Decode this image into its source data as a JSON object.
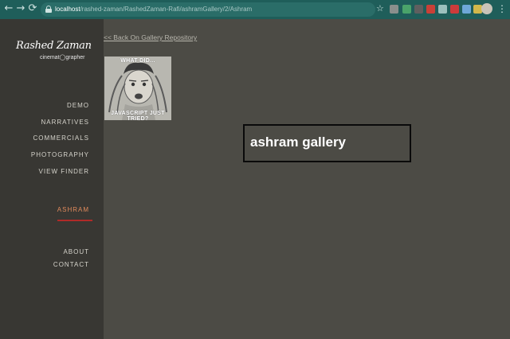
{
  "browser": {
    "url_host": "localhost",
    "url_path": "/rashed-zaman/RashedZaman-Rafi/ashramGallery/2/Ashram",
    "nav_back_icon": "←",
    "nav_forward_icon": "→",
    "nav_reload_icon": "⟳",
    "star_icon": "☆",
    "menu_icon": "⋮",
    "extension_colors": [
      "#8a8f8c",
      "#4aa36a",
      "#5f5f5f",
      "#c94037",
      "#9cc0bd",
      "#cc3b3b",
      "#6ea8d8",
      "#d2b84b"
    ]
  },
  "sidebar": {
    "logo_name": "Rashed Zaman",
    "logo_role": "cinemat◯grapher",
    "menu": [
      {
        "label": "DEMO"
      },
      {
        "label": "NARRATIVES"
      },
      {
        "label": "COMMERCIALS"
      },
      {
        "label": "PHOTOGRAPHY"
      },
      {
        "label": "VIEW FINDER"
      }
    ],
    "active_item": "ASHRAM",
    "bottom_menu": [
      {
        "label": "ABOUT"
      },
      {
        "label": "CONTACT"
      }
    ],
    "colors": {
      "active": "#e08a5c",
      "underline": "#b02a28"
    }
  },
  "main": {
    "back_link": "<< Back On Gallery Repository",
    "thumbnail": {
      "caption_top": "WHAT DID...",
      "caption_bottom": "JAVASCRIPT JUST TRIED?"
    },
    "gallery_title": "ashram gallery"
  }
}
